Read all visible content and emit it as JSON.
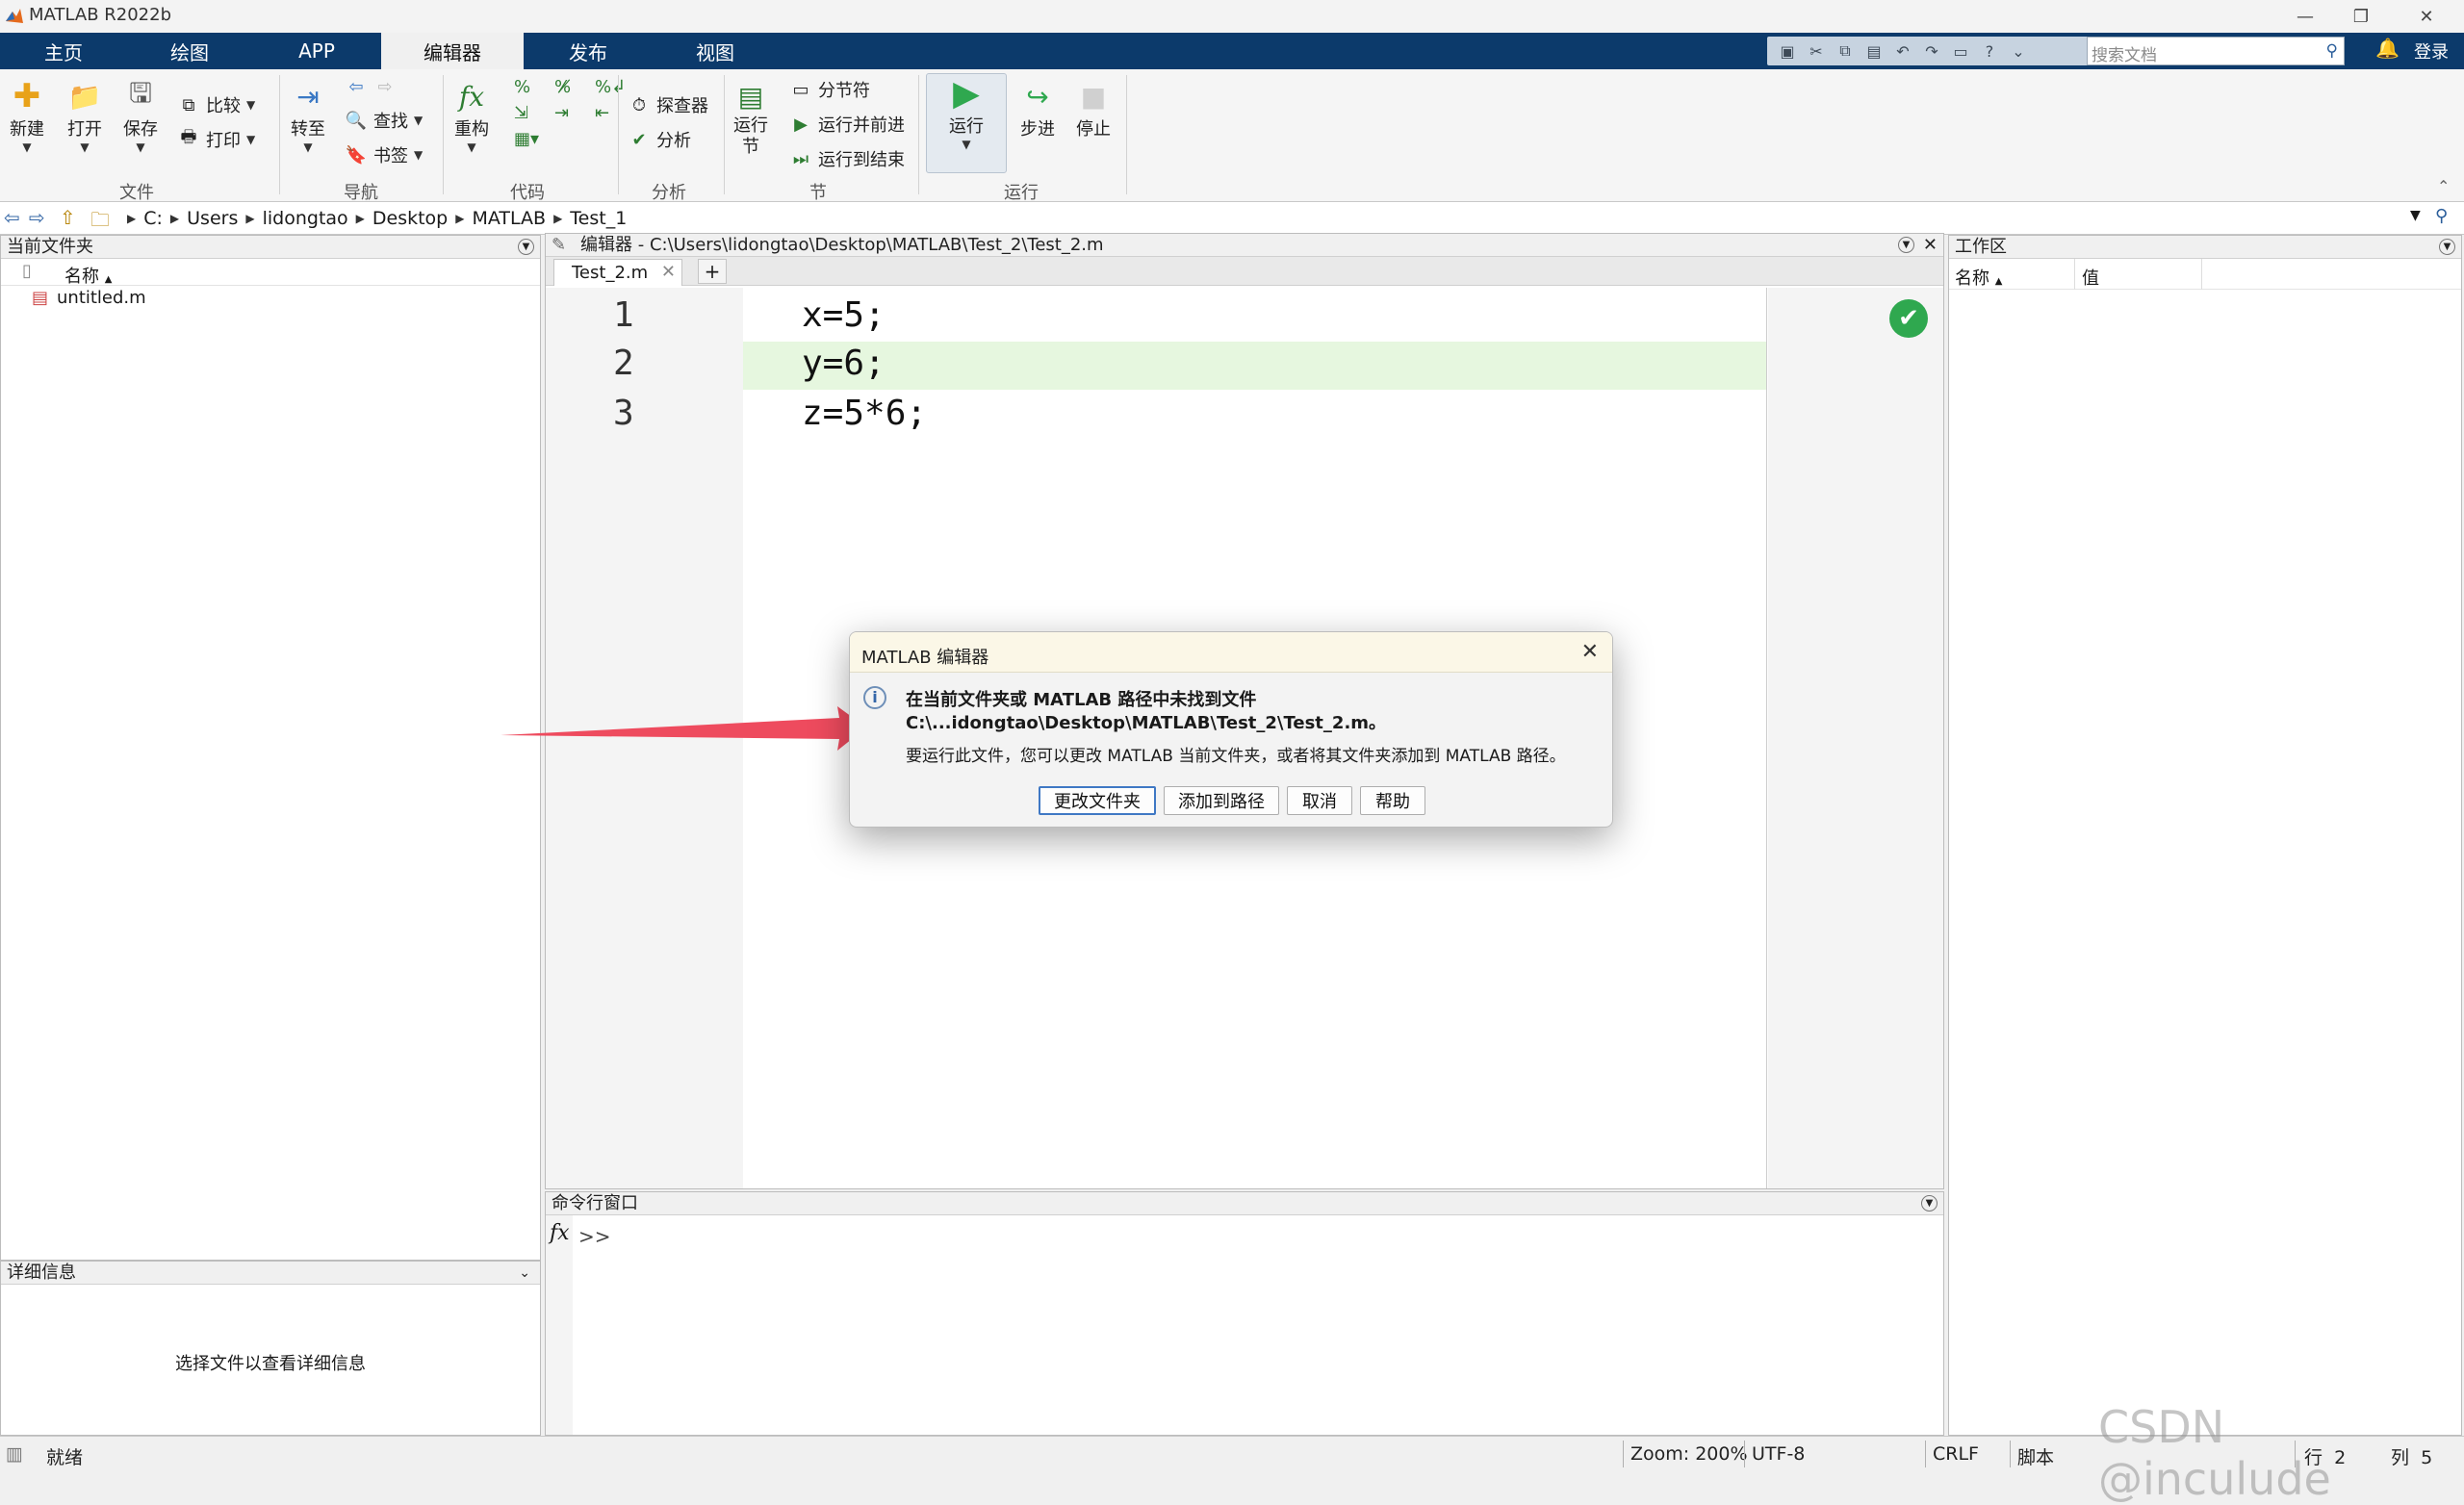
{
  "window": {
    "title": "MATLAB R2022b"
  },
  "tabs": [
    "主页",
    "绘图",
    "APP",
    "编辑器",
    "发布",
    "视图"
  ],
  "search": {
    "placeholder": "搜索文档"
  },
  "login": "登录",
  "ribbon": {
    "new": "新建",
    "open": "打开",
    "save": "保存",
    "compare": "比较",
    "print": "打印",
    "group_file": "文件",
    "goto": "转至",
    "find": "查找",
    "bookmark": "书签",
    "group_nav": "导航",
    "refactor": "重构",
    "group_code": "代码",
    "profiler": "探查器",
    "analyze": "分析",
    "group_analyze": "分析",
    "run_section": "运行\n节",
    "section_break": "分节符",
    "run_advance": "运行并前进",
    "run_to_end": "运行到结束",
    "group_section": "节",
    "run": "运行",
    "step": "步进",
    "stop": "停止",
    "group_run": "运行"
  },
  "path": [
    "C:",
    "Users",
    "lidongtao",
    "Desktop",
    "MATLAB",
    "Test_1"
  ],
  "current_folder": {
    "title": "当前文件夹",
    "col_name": "名称",
    "files": [
      "untitled.m"
    ]
  },
  "details": {
    "title": "详细信息",
    "empty": "选择文件以查看详细信息"
  },
  "editor": {
    "title": "编辑器 - C:\\Users\\lidongtao\\Desktop\\MATLAB\\Test_2\\Test_2.m",
    "tab": "Test_2.m",
    "add_tab": "+",
    "lines": [
      {
        "num": "1",
        "code": "x=5;"
      },
      {
        "num": "2",
        "code": "y=6;"
      },
      {
        "num": "3",
        "code": "z=5*6;"
      }
    ]
  },
  "command_window": {
    "title": "命令行窗口",
    "prompt": ">>",
    "fx": "fx"
  },
  "workspace": {
    "title": "工作区",
    "col_name": "名称",
    "col_value": "值"
  },
  "dialog": {
    "title": "MATLAB 编辑器",
    "heading": "在当前文件夹或 MATLAB 路径中未找到文件",
    "path": "C:\\...idongtao\\Desktop\\MATLAB\\Test_2\\Test_2.m。",
    "message": "要运行此文件，您可以更改 MATLAB 当前文件夹，或者将其文件夹添加到 MATLAB 路径。",
    "buttons": {
      "change": "更改文件夹",
      "add_path": "添加到路径",
      "cancel": "取消",
      "help": "帮助"
    }
  },
  "status": {
    "ready": "就绪",
    "zoom": "Zoom: 200%",
    "encoding": "UTF-8",
    "eol": "CRLF",
    "type": "脚本",
    "row": "行  2",
    "col": "列  5"
  },
  "watermark": "CSDN @inculude",
  "colors": {
    "tabbar": "#0c3a6b",
    "highlight_line": "#e6f7df",
    "arrow": "#ee4b5e",
    "run_green": "#2fa84f"
  }
}
